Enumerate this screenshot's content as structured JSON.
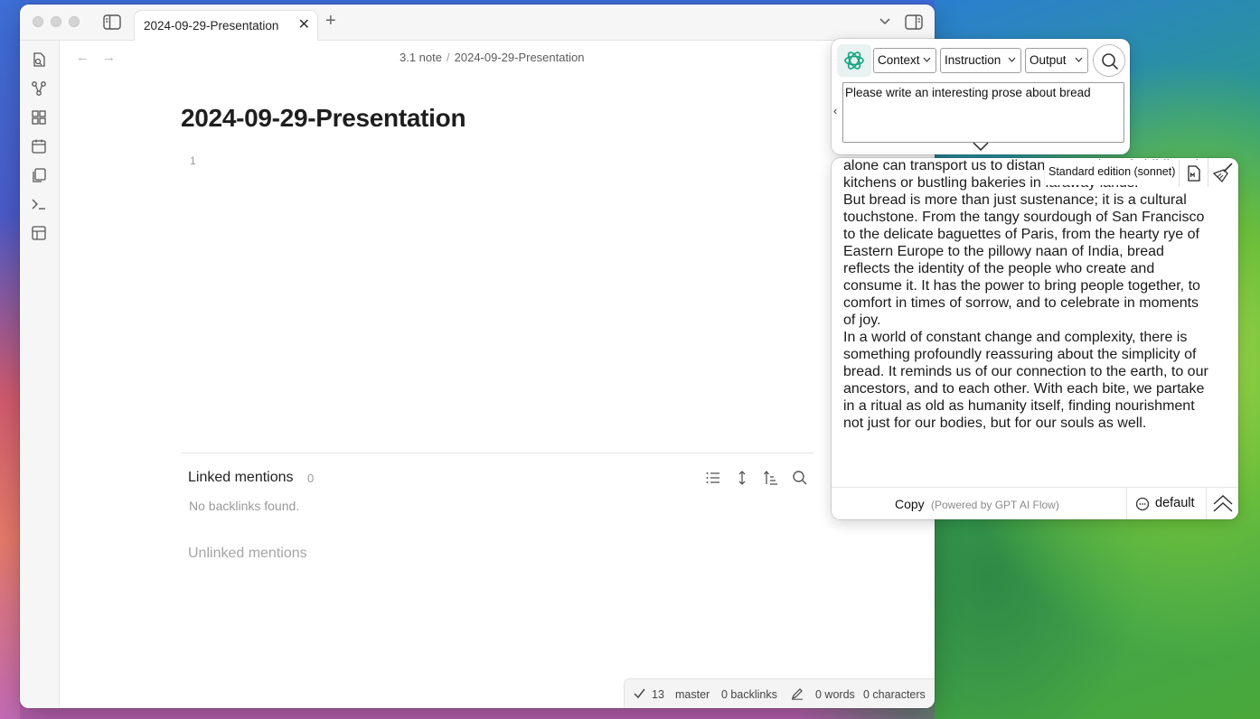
{
  "window": {
    "tab_title": "2024-09-29-Presentation",
    "tab_close": "✕",
    "new_tab": "+"
  },
  "ribbon": {
    "icons": [
      "open-quick-switcher-icon",
      "graph-view-icon",
      "canvas-icon",
      "daily-note-icon",
      "templates-icon",
      "command-palette-icon",
      "layout-icon"
    ]
  },
  "nav": {
    "back": "←",
    "forward": "→",
    "breadcrumb": [
      "3.1 note",
      "2024-09-29-Presentation"
    ],
    "breadcrumb_sep": "/"
  },
  "editor": {
    "title": "2024-09-29-Presentation",
    "line_number": "1"
  },
  "backlinks": {
    "linked_title": "Linked mentions",
    "linked_count": "0",
    "empty_text": "No backlinks found.",
    "unlinked_title": "Unlinked mentions"
  },
  "statusbar": {
    "sync_count": "13",
    "branch": "master",
    "backlinks": "0 backlinks",
    "words": "0 words",
    "characters": "0 characters"
  },
  "gpt_flow": {
    "selects": {
      "context": "Context",
      "instruction": "Instruction",
      "output": "Output"
    },
    "collapse_left": "‹",
    "prompt": "Please write an interesting prose about bread",
    "model": "Standard edition (sonnet)",
    "output_paragraphs": [
      "loaf is a sensory experience unlike any other. The aroma alone can transport us to distant memories of childhood kitchens or bustling bakeries in faraway lands.",
      "But bread is more than just sustenance; it is a cultural touchstone. From the tangy sourdough of San Francisco to the delicate baguettes of Paris, from the hearty rye of Eastern Europe to the pillowy naan of India, bread reflects the identity of the people who create and consume it. It has the power to bring people together, to comfort in times of sorrow, and to celebrate in moments of joy.",
      "In a world of constant change and complexity, there is something profoundly reassuring about the simplicity of bread. It reminds us of our connection to the earth, to our ancestors, and to each other. With each bite, we partake in a ritual as old as humanity itself, finding nourishment not just for our bodies, but for our souls as well."
    ],
    "copy_label": "Copy",
    "powered_by": "(Powered by GPT AI Flow)",
    "default_label": "default"
  }
}
